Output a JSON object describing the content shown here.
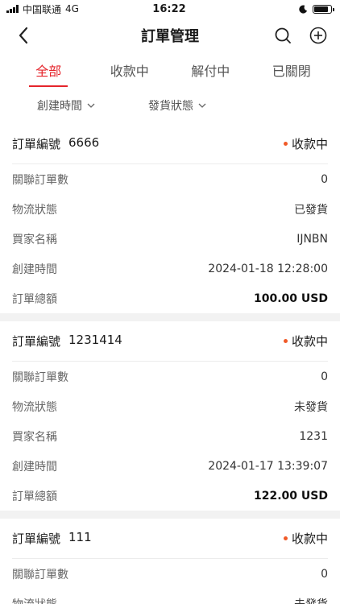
{
  "status_bar": {
    "carrier": "中国联通",
    "network": "4G",
    "time": "16:22",
    "battery_level": 0.85
  },
  "nav": {
    "title": "訂單管理",
    "icons": [
      "back-icon",
      "search-icon",
      "add-icon"
    ]
  },
  "tabs": [
    {
      "label": "全部",
      "active": true
    },
    {
      "label": "收款中",
      "active": false
    },
    {
      "label": "解付中",
      "active": false
    },
    {
      "label": "已關閉",
      "active": false
    }
  ],
  "filters": [
    {
      "label": "創建時間"
    },
    {
      "label": "發貨狀態"
    }
  ],
  "colors": {
    "accent": "#e5242b",
    "status_dot": "#f05a28"
  },
  "orders": [
    {
      "order_label": "訂單編號",
      "order_no": "6666",
      "status": "收款中",
      "rows": [
        {
          "label": "關聯訂單數",
          "value": "0",
          "bold": false
        },
        {
          "label": "物流狀態",
          "value": "已發貨",
          "bold": false
        },
        {
          "label": "買家名稱",
          "value": "IJNBN",
          "bold": false
        },
        {
          "label": "創建時間",
          "value": "2024-01-18 12:28:00",
          "bold": false
        },
        {
          "label": "訂單總額",
          "value": "100.00 USD",
          "bold": true
        }
      ]
    },
    {
      "order_label": "訂單編號",
      "order_no": "1231414",
      "status": "收款中",
      "rows": [
        {
          "label": "關聯訂單數",
          "value": "0",
          "bold": false
        },
        {
          "label": "物流狀態",
          "value": "未發貨",
          "bold": false
        },
        {
          "label": "買家名稱",
          "value": "1231",
          "bold": false
        },
        {
          "label": "創建時間",
          "value": "2024-01-17 13:39:07",
          "bold": false
        },
        {
          "label": "訂單總額",
          "value": "122.00 USD",
          "bold": true
        }
      ]
    },
    {
      "order_label": "訂單編號",
      "order_no": "111",
      "status": "收款中",
      "rows": [
        {
          "label": "關聯訂單數",
          "value": "0",
          "bold": false
        },
        {
          "label": "物流狀態",
          "value": "未發貨",
          "bold": false
        }
      ]
    }
  ]
}
